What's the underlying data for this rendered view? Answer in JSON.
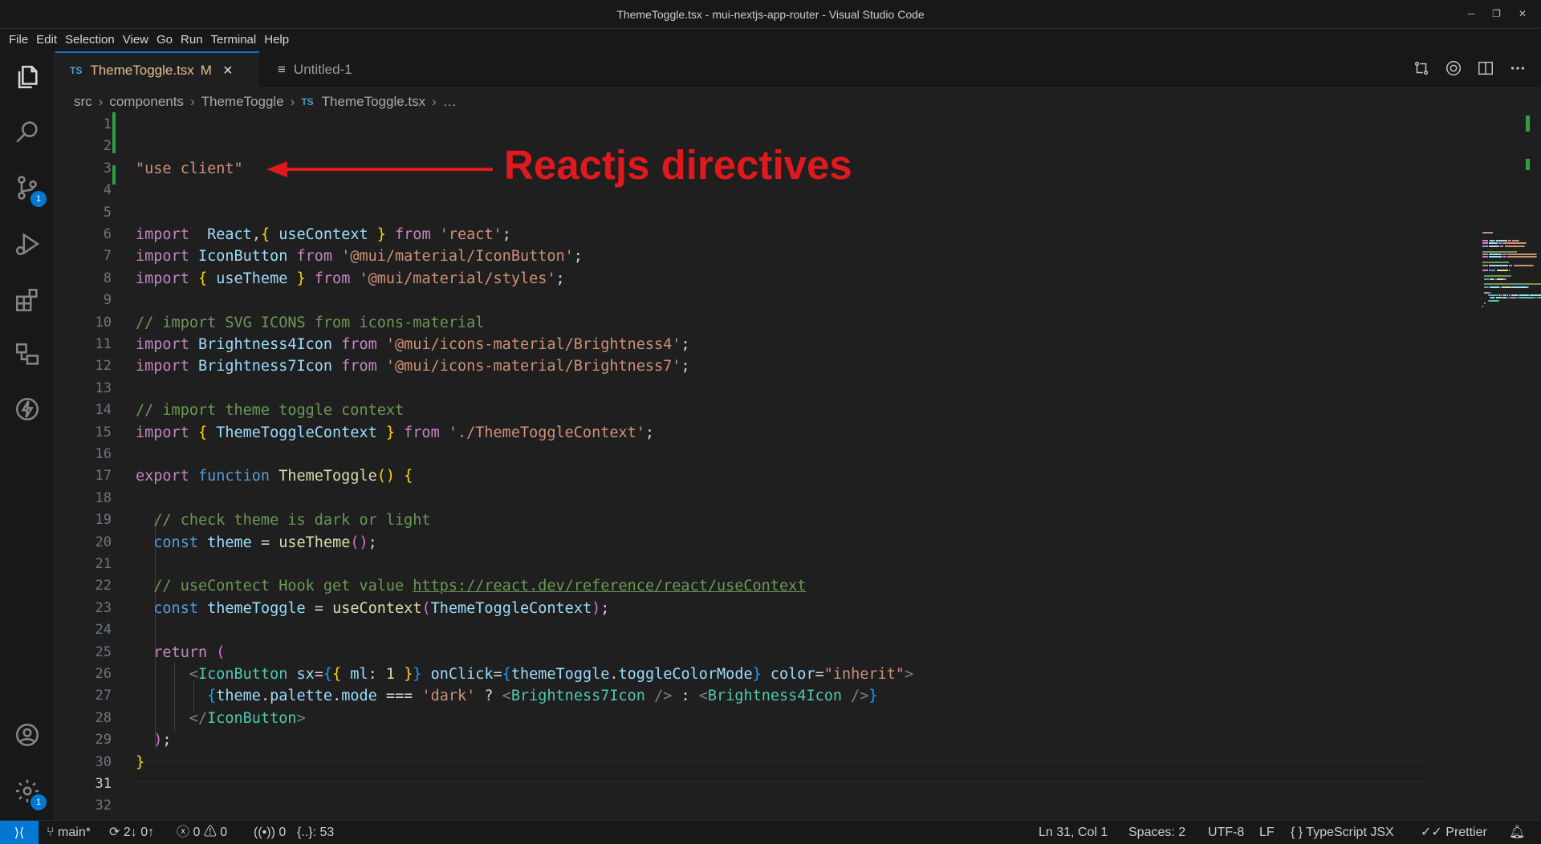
{
  "window": {
    "title": "ThemeToggle.tsx - mui-nextjs-app-router - Visual Studio Code"
  },
  "menu": [
    "File",
    "Edit",
    "Selection",
    "View",
    "Go",
    "Run",
    "Terminal",
    "Help"
  ],
  "activity_bar": {
    "source_control_badge": "1",
    "settings_badge": "1"
  },
  "tabs": [
    {
      "label": "ThemeToggle.tsx",
      "lang_badge": "TS",
      "modified_flag": "M",
      "close": "×",
      "active": true
    },
    {
      "label": "Untitled-1",
      "active": false
    }
  ],
  "breadcrumb": [
    "src",
    "components",
    "ThemeToggle",
    "ThemeToggle.tsx",
    "…"
  ],
  "breadcrumb_ts_badge": "TS",
  "editor": {
    "line_numbers": [
      "1",
      "2",
      "3",
      "4",
      "5",
      "6",
      "7",
      "8",
      "9",
      "10",
      "11",
      "12",
      "13",
      "14",
      "15",
      "16",
      "17",
      "18",
      "19",
      "20",
      "21",
      "22",
      "23",
      "24",
      "25",
      "26",
      "27",
      "28",
      "29",
      "30",
      "31",
      "32"
    ],
    "current_line": "31",
    "lines": [
      [],
      [],
      [
        {
          "t": "\"use client\"",
          "c": "t-str"
        }
      ],
      [],
      [],
      [
        {
          "t": "import",
          "c": "t-kw"
        },
        {
          "t": "  ",
          "c": "t-pun"
        },
        {
          "t": "React",
          "c": "t-var"
        },
        {
          "t": ",",
          "c": "t-pun"
        },
        {
          "t": "{",
          "c": "t-br1"
        },
        {
          "t": " useContext ",
          "c": "t-var"
        },
        {
          "t": "}",
          "c": "t-br1"
        },
        {
          "t": " ",
          "c": "t-pun"
        },
        {
          "t": "from",
          "c": "t-kw"
        },
        {
          "t": " ",
          "c": "t-pun"
        },
        {
          "t": "'react'",
          "c": "t-str"
        },
        {
          "t": ";",
          "c": "t-pun"
        }
      ],
      [
        {
          "t": "import",
          "c": "t-kw"
        },
        {
          "t": " ",
          "c": "t-pun"
        },
        {
          "t": "IconButton",
          "c": "t-var"
        },
        {
          "t": " ",
          "c": "t-pun"
        },
        {
          "t": "from",
          "c": "t-kw"
        },
        {
          "t": " ",
          "c": "t-pun"
        },
        {
          "t": "'@mui/material/IconButton'",
          "c": "t-str"
        },
        {
          "t": ";",
          "c": "t-pun"
        }
      ],
      [
        {
          "t": "import",
          "c": "t-kw"
        },
        {
          "t": " ",
          "c": "t-pun"
        },
        {
          "t": "{",
          "c": "t-br1"
        },
        {
          "t": " useTheme ",
          "c": "t-var"
        },
        {
          "t": "}",
          "c": "t-br1"
        },
        {
          "t": " ",
          "c": "t-pun"
        },
        {
          "t": "from",
          "c": "t-kw"
        },
        {
          "t": " ",
          "c": "t-pun"
        },
        {
          "t": "'@mui/material/styles'",
          "c": "t-str"
        },
        {
          "t": ";",
          "c": "t-pun"
        }
      ],
      [],
      [
        {
          "t": "// import SVG ICONS from icons-material",
          "c": "t-cm"
        }
      ],
      [
        {
          "t": "import",
          "c": "t-kw"
        },
        {
          "t": " ",
          "c": "t-pun"
        },
        {
          "t": "Brightness4Icon",
          "c": "t-var"
        },
        {
          "t": " ",
          "c": "t-pun"
        },
        {
          "t": "from",
          "c": "t-kw"
        },
        {
          "t": " ",
          "c": "t-pun"
        },
        {
          "t": "'@mui/icons-material/Brightness4'",
          "c": "t-str"
        },
        {
          "t": ";",
          "c": "t-pun"
        }
      ],
      [
        {
          "t": "import",
          "c": "t-kw"
        },
        {
          "t": " ",
          "c": "t-pun"
        },
        {
          "t": "Brightness7Icon",
          "c": "t-var"
        },
        {
          "t": " ",
          "c": "t-pun"
        },
        {
          "t": "from",
          "c": "t-kw"
        },
        {
          "t": " ",
          "c": "t-pun"
        },
        {
          "t": "'@mui/icons-material/Brightness7'",
          "c": "t-str"
        },
        {
          "t": ";",
          "c": "t-pun"
        }
      ],
      [],
      [
        {
          "t": "// import theme toggle context",
          "c": "t-cm"
        }
      ],
      [
        {
          "t": "import",
          "c": "t-kw"
        },
        {
          "t": " ",
          "c": "t-pun"
        },
        {
          "t": "{",
          "c": "t-br1"
        },
        {
          "t": " ThemeToggleContext ",
          "c": "t-var"
        },
        {
          "t": "}",
          "c": "t-br1"
        },
        {
          "t": " ",
          "c": "t-pun"
        },
        {
          "t": "from",
          "c": "t-kw"
        },
        {
          "t": " ",
          "c": "t-pun"
        },
        {
          "t": "'./ThemeToggleContext'",
          "c": "t-str"
        },
        {
          "t": ";",
          "c": "t-pun"
        }
      ],
      [],
      [
        {
          "t": "export",
          "c": "t-kw"
        },
        {
          "t": " ",
          "c": "t-pun"
        },
        {
          "t": "function",
          "c": "t-blue"
        },
        {
          "t": " ",
          "c": "t-pun"
        },
        {
          "t": "ThemeToggle",
          "c": "t-fn"
        },
        {
          "t": "()",
          "c": "t-br1"
        },
        {
          "t": " ",
          "c": "t-pun"
        },
        {
          "t": "{",
          "c": "t-br1"
        }
      ],
      [],
      [
        {
          "t": "  ",
          "c": "t-pun"
        },
        {
          "t": "// check theme is dark or light",
          "c": "t-cm"
        }
      ],
      [
        {
          "t": "  ",
          "c": "t-pun"
        },
        {
          "t": "const",
          "c": "t-blue"
        },
        {
          "t": " ",
          "c": "t-pun"
        },
        {
          "t": "theme",
          "c": "t-var"
        },
        {
          "t": " = ",
          "c": "t-pun"
        },
        {
          "t": "useTheme",
          "c": "t-fn"
        },
        {
          "t": "()",
          "c": "t-br2"
        },
        {
          "t": ";",
          "c": "t-pun"
        }
      ],
      [],
      [
        {
          "t": "  ",
          "c": "t-pun"
        },
        {
          "t": "// useContect Hook get value ",
          "c": "t-cm"
        },
        {
          "t": "https://react.dev/reference/react/useContext",
          "c": "t-link"
        }
      ],
      [
        {
          "t": "  ",
          "c": "t-pun"
        },
        {
          "t": "const",
          "c": "t-blue"
        },
        {
          "t": " ",
          "c": "t-pun"
        },
        {
          "t": "themeToggle",
          "c": "t-var"
        },
        {
          "t": " = ",
          "c": "t-pun"
        },
        {
          "t": "useContext",
          "c": "t-fn"
        },
        {
          "t": "(",
          "c": "t-br2"
        },
        {
          "t": "ThemeToggleContext",
          "c": "t-var"
        },
        {
          "t": ")",
          "c": "t-br2"
        },
        {
          "t": ";",
          "c": "t-pun"
        }
      ],
      [],
      [
        {
          "t": "  ",
          "c": "t-pun"
        },
        {
          "t": "return",
          "c": "t-kw"
        },
        {
          "t": " ",
          "c": "t-pun"
        },
        {
          "t": "(",
          "c": "t-br2"
        }
      ],
      [
        {
          "t": "      ",
          "c": "t-pun"
        },
        {
          "t": "<",
          "c": "t-tag"
        },
        {
          "t": "IconButton",
          "c": "t-type"
        },
        {
          "t": " ",
          "c": "t-pun"
        },
        {
          "t": "sx",
          "c": "t-var"
        },
        {
          "t": "=",
          "c": "t-pun"
        },
        {
          "t": "{",
          "c": "t-br3"
        },
        {
          "t": "{",
          "c": "t-br1"
        },
        {
          "t": " ",
          "c": "t-pun"
        },
        {
          "t": "ml",
          "c": "t-var"
        },
        {
          "t": ": ",
          "c": "t-pun"
        },
        {
          "t": "1",
          "c": "t-fn"
        },
        {
          "t": " ",
          "c": "t-pun"
        },
        {
          "t": "}",
          "c": "t-br1"
        },
        {
          "t": "}",
          "c": "t-br3"
        },
        {
          "t": " ",
          "c": "t-pun"
        },
        {
          "t": "onClick",
          "c": "t-var"
        },
        {
          "t": "=",
          "c": "t-pun"
        },
        {
          "t": "{",
          "c": "t-br3"
        },
        {
          "t": "themeToggle",
          "c": "t-var"
        },
        {
          "t": ".",
          "c": "t-pun"
        },
        {
          "t": "toggleColorMode",
          "c": "t-var"
        },
        {
          "t": "}",
          "c": "t-br3"
        },
        {
          "t": " ",
          "c": "t-pun"
        },
        {
          "t": "color",
          "c": "t-var"
        },
        {
          "t": "=",
          "c": "t-pun"
        },
        {
          "t": "\"inherit\"",
          "c": "t-str"
        },
        {
          "t": ">",
          "c": "t-tag"
        }
      ],
      [
        {
          "t": "        ",
          "c": "t-pun"
        },
        {
          "t": "{",
          "c": "t-br3"
        },
        {
          "t": "theme",
          "c": "t-var"
        },
        {
          "t": ".",
          "c": "t-pun"
        },
        {
          "t": "palette",
          "c": "t-var"
        },
        {
          "t": ".",
          "c": "t-pun"
        },
        {
          "t": "mode",
          "c": "t-var"
        },
        {
          "t": " === ",
          "c": "t-pun"
        },
        {
          "t": "'dark'",
          "c": "t-str"
        },
        {
          "t": " ? ",
          "c": "t-pun"
        },
        {
          "t": "<",
          "c": "t-tag"
        },
        {
          "t": "Brightness7Icon",
          "c": "t-type"
        },
        {
          "t": " />",
          "c": "t-tag"
        },
        {
          "t": " : ",
          "c": "t-pun"
        },
        {
          "t": "<",
          "c": "t-tag"
        },
        {
          "t": "Brightness4Icon",
          "c": "t-type"
        },
        {
          "t": " />",
          "c": "t-tag"
        },
        {
          "t": "}",
          "c": "t-br3"
        }
      ],
      [
        {
          "t": "      ",
          "c": "t-pun"
        },
        {
          "t": "</",
          "c": "t-tag"
        },
        {
          "t": "IconButton",
          "c": "t-type"
        },
        {
          "t": ">",
          "c": "t-tag"
        }
      ],
      [
        {
          "t": "  ",
          "c": "t-pun"
        },
        {
          "t": ")",
          "c": "t-br2"
        },
        {
          "t": ";",
          "c": "t-pun"
        }
      ],
      [
        {
          "t": "}",
          "c": "t-br1"
        }
      ],
      [],
      []
    ]
  },
  "annotation": {
    "text": "Reactjs directives",
    "color": "#e0191f"
  },
  "status_bar": {
    "branch": "main*",
    "sync": "2↓ 0↑",
    "errors": "0",
    "warnings": "0",
    "ports": "0",
    "outline": "{..}: 53",
    "cursor": "Ln 31, Col 1",
    "spaces": "Spaces: 2",
    "encoding": "UTF-8",
    "eol": "LF",
    "language_prefix": "{ }",
    "language": "TypeScript JSX",
    "formatter": "Prettier"
  },
  "colors": {
    "accent": "#0078d4",
    "git_added": "#2ea043"
  }
}
